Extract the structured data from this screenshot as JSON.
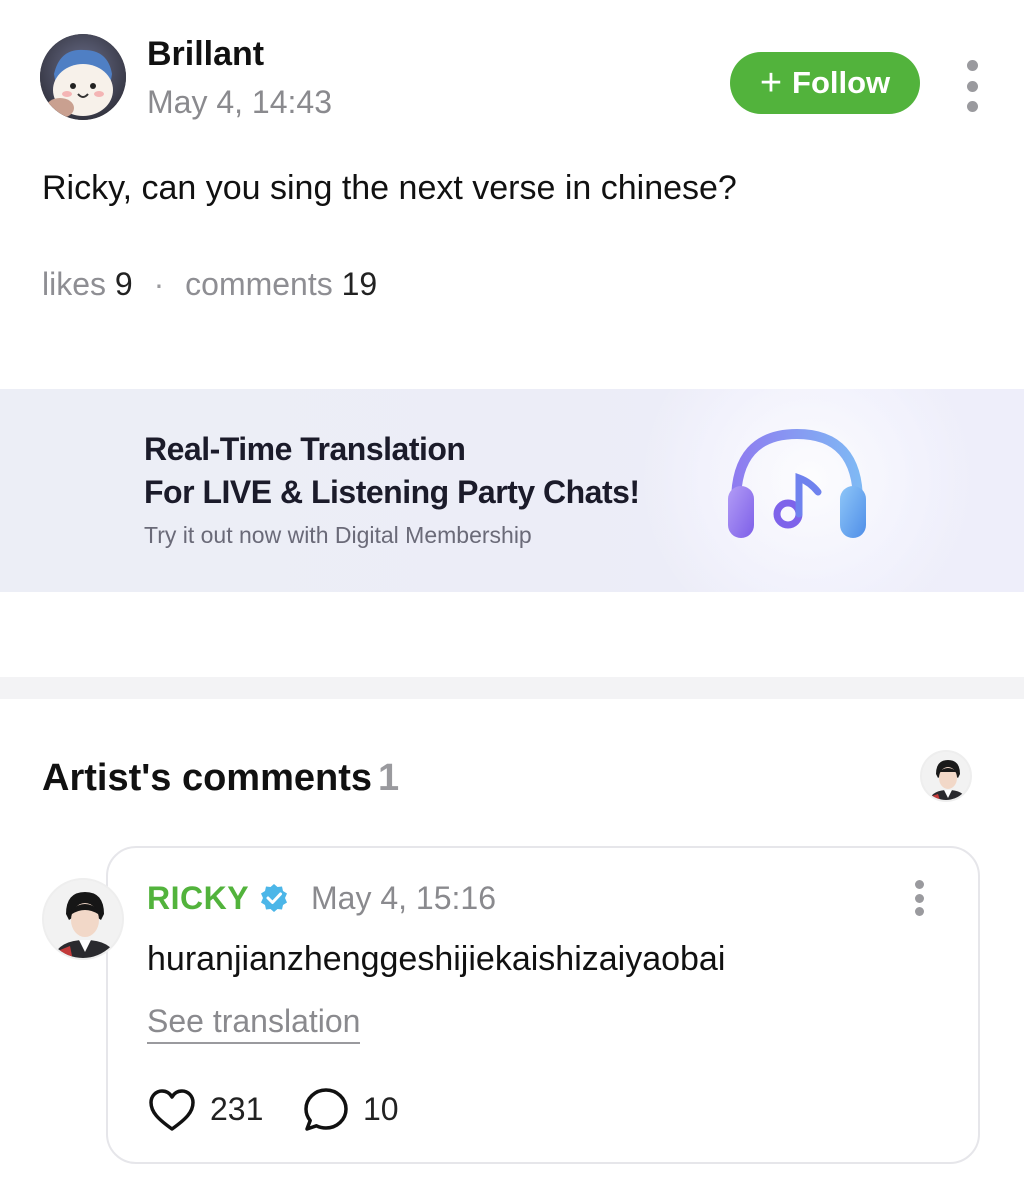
{
  "post": {
    "author": "Brillant",
    "timestamp": "May 4, 14:43",
    "follow_label": "Follow",
    "text": "Ricky, can you sing the next verse in chinese?",
    "likes_label": "likes",
    "likes_count": "9",
    "separator": "·",
    "comments_label": "comments",
    "comments_count": "19"
  },
  "banner": {
    "line1": "Real-Time Translation",
    "line2": "For LIVE & Listening Party Chats!",
    "subtitle": "Try it out now with Digital Membership",
    "icon": "headphones-music-icon"
  },
  "artist_comments": {
    "title": "Artist's comments",
    "count": "1",
    "comment": {
      "author": "RICKY",
      "timestamp": "May 4, 15:16",
      "text": "huranjianzhenggeshijiekaishizaiyaobai",
      "see_translation": "See translation",
      "likes": "231",
      "replies": "10"
    }
  },
  "colors": {
    "accent_green": "#52b33c",
    "verified_blue": "#4cb6e8",
    "muted_text": "#8a8a8e"
  }
}
